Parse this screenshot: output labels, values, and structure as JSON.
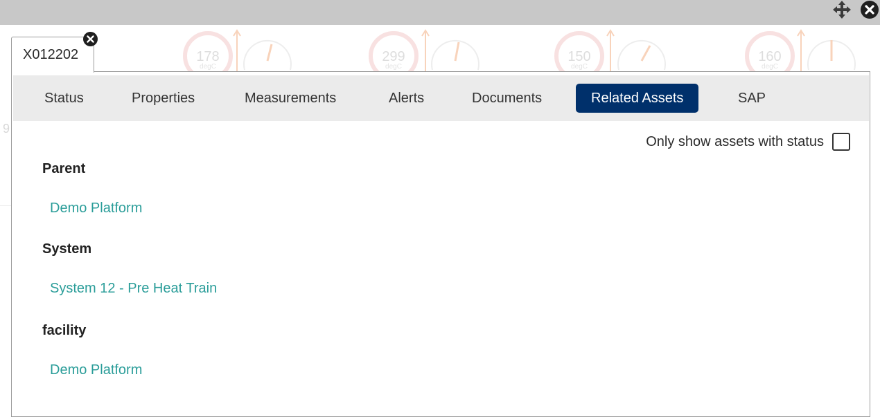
{
  "asset_tab": {
    "label": "X012202"
  },
  "background_gauges": [
    {
      "value": "178",
      "unit": "degC"
    },
    {
      "value": "299",
      "unit": "degC"
    },
    {
      "value": "150",
      "unit": "degC"
    },
    {
      "value": "160",
      "unit": "degC"
    }
  ],
  "background_text": "9",
  "nav": {
    "items": [
      {
        "label": "Status",
        "active": false
      },
      {
        "label": "Properties",
        "active": false
      },
      {
        "label": "Measurements",
        "active": false
      },
      {
        "label": "Alerts",
        "active": false
      },
      {
        "label": "Documents",
        "active": false
      },
      {
        "label": "Related Assets",
        "active": true
      },
      {
        "label": "SAP",
        "active": false
      }
    ]
  },
  "filter": {
    "label": "Only show assets with status",
    "checked": false
  },
  "related": {
    "parent": {
      "title": "Parent",
      "link": "Demo Platform"
    },
    "system": {
      "title": "System",
      "link": "System 12 - Pre Heat Train"
    },
    "facility": {
      "title": "facility",
      "link": "Demo Platform"
    }
  },
  "colors": {
    "active_tab": "#00306b",
    "link": "#2a9d99",
    "top_bar": "#c8c8c8"
  },
  "icons": [
    "move-icon",
    "close-icon",
    "tab-close-icon"
  ]
}
